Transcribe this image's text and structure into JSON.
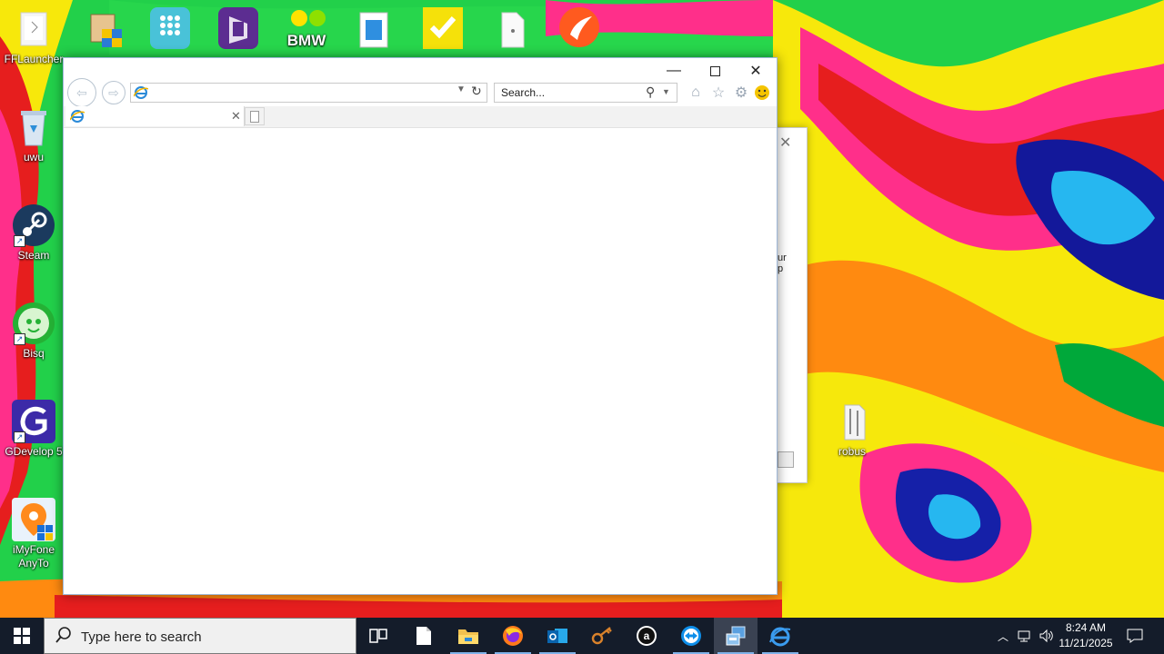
{
  "desktop": {
    "icons": [
      {
        "label": "FFLauncher",
        "icon": "folder-icon"
      },
      {
        "label": "uwu",
        "icon": "recycle-bin-icon"
      },
      {
        "label": "Steam",
        "icon": "steam-icon"
      },
      {
        "label": "Bisq",
        "icon": "bisq-icon"
      },
      {
        "label": "GDevelop 5",
        "icon": "gdevelop-icon"
      },
      {
        "label": "iMyFone AnyTo",
        "icon": "imyfone-icon"
      },
      {
        "label": "robus",
        "icon": "folder-icon"
      }
    ],
    "top_row_icons": [
      "installer-icon",
      "dialpad-app-icon",
      "visual-studio-icon",
      "bmw-icon",
      "folder-docs-icon",
      "checkmark-app-icon",
      "file-icon",
      "orange-app-icon"
    ],
    "top_row_text": "BMW"
  },
  "background_dialog": {
    "fragment_line1": "ur",
    "fragment_line2": "p"
  },
  "browser": {
    "address_value": "",
    "search_placeholder": "Search...",
    "tab_title": ""
  },
  "taskbar": {
    "search_placeholder": "Type here to search",
    "time": "8:24 AM",
    "date": "11/21/2025",
    "apps": [
      "task-view-icon",
      "notepad-icon",
      "file-explorer-icon",
      "firefox-icon",
      "outlook-icon",
      "key-app-icon",
      "amazon-icon",
      "teamviewer-icon",
      "control-panel-icon",
      "internet-explorer-icon"
    ]
  },
  "colors": {
    "taskbar": "#141c2a",
    "accent": "#1a6fd6"
  }
}
